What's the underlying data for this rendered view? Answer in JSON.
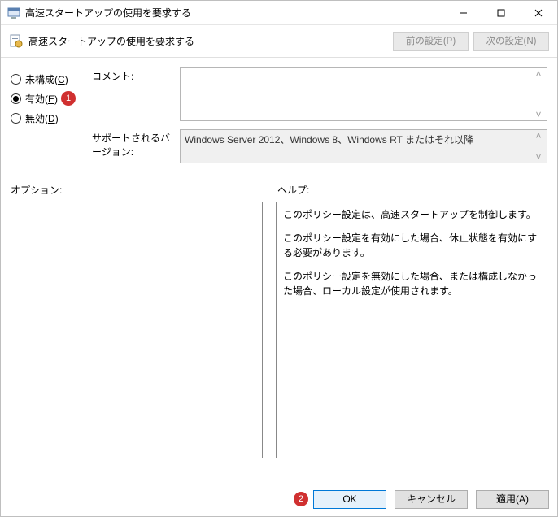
{
  "window": {
    "title": "高速スタートアップの使用を要求する",
    "subtitle": "高速スタートアップの使用を要求する"
  },
  "nav": {
    "prev": "前の設定(P)",
    "next": "次の設定(N)"
  },
  "radios": {
    "not_configured": "未構成",
    "not_configured_key": "C",
    "enabled": "有効",
    "enabled_key": "E",
    "disabled": "無効",
    "disabled_key": "D",
    "selected": "enabled"
  },
  "markers": {
    "m1": "1",
    "m2": "2"
  },
  "fields": {
    "comment_label": "コメント:",
    "comment_value": "",
    "supported_label": "サポートされるバージョン:",
    "supported_value": "Windows Server 2012、Windows 8、Windows RT またはそれ以降"
  },
  "sections": {
    "options_label": "オプション:",
    "help_label": "ヘルプ:"
  },
  "help": {
    "p1": "このポリシー設定は、高速スタートアップを制御します。",
    "p2": "このポリシー設定を有効にした場合、休止状態を有効にする必要があります。",
    "p3": "このポリシー設定を無効にした場合、または構成しなかった場合、ローカル設定が使用されます。"
  },
  "buttons": {
    "ok": "OK",
    "cancel": "キャンセル",
    "apply": "適用(A)"
  },
  "colors": {
    "marker_bg": "#d03030",
    "ok_border": "#0078d7"
  }
}
